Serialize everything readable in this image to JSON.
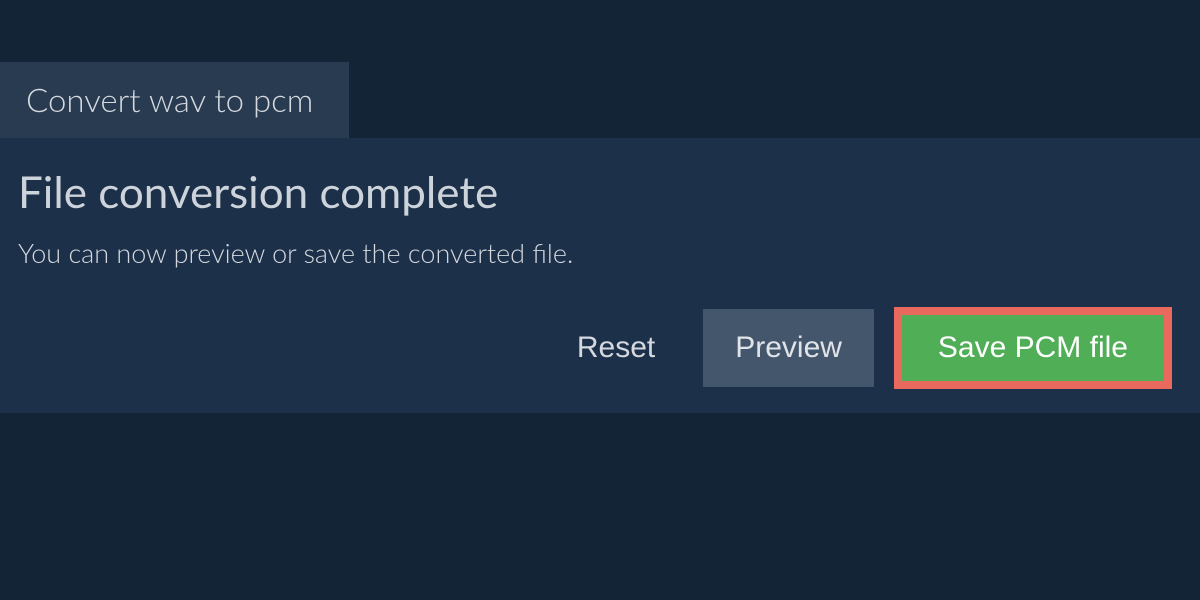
{
  "tab": {
    "label": "Convert wav to pcm"
  },
  "panel": {
    "heading": "File conversion complete",
    "subtext": "You can now preview or save the converted file."
  },
  "buttons": {
    "reset": "Reset",
    "preview": "Preview",
    "save": "Save PCM file"
  }
}
